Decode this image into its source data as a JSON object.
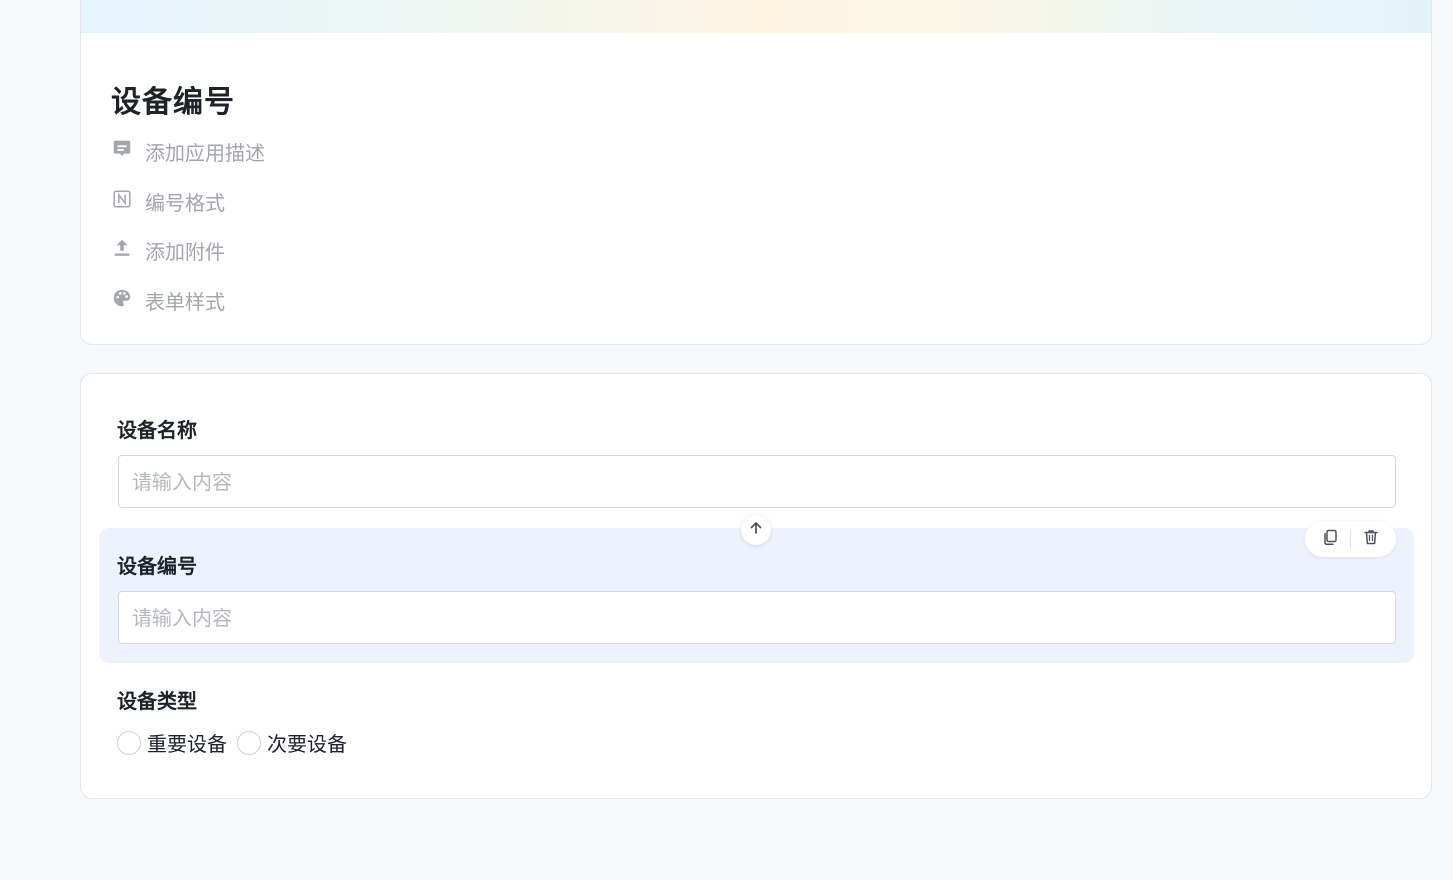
{
  "form": {
    "title": "设备编号",
    "actions": [
      {
        "label": "添加应用描述",
        "icon": "comment-icon"
      },
      {
        "label": "编号格式",
        "icon": "n-format-icon"
      },
      {
        "label": "添加附件",
        "icon": "upload-icon"
      },
      {
        "label": "表单样式",
        "icon": "palette-icon"
      }
    ]
  },
  "fields": {
    "device_name": {
      "label": "设备名称",
      "placeholder": "请输入内容"
    },
    "device_number": {
      "label": "设备编号",
      "placeholder": "请输入内容"
    },
    "device_type": {
      "label": "设备类型",
      "options": [
        "重要设备",
        "次要设备"
      ]
    }
  },
  "colors": {
    "selected_field_bg": "#eef2fd",
    "muted_text": "#a3a6ad",
    "page_bg": "#f7f8fa"
  }
}
